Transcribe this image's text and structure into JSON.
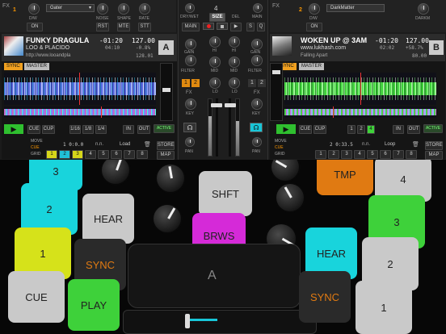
{
  "fx_left": {
    "label": "FX",
    "unit": "1",
    "effect": "Gater",
    "dw_label": "D/W",
    "on_label": "ON",
    "knob_labels": [
      "NOISE",
      "SHAPE",
      "RATE"
    ],
    "button_labels": [
      "RST",
      "MTE",
      "STT"
    ]
  },
  "fx_right": {
    "label": "FX",
    "unit": "2",
    "effect": "DarkMatter",
    "dw_label": "D/W",
    "on_label": "ON",
    "knob_labels": [
      "DARKM"
    ]
  },
  "mixer_top": {
    "dry_wet": "DRY/WET",
    "del": "DEL",
    "size_label": "SIZE",
    "size_value": "4",
    "main_left": "MAIN",
    "main_right": "MAIN",
    "s": "S",
    "q": "Q",
    "gain": "GAIN",
    "hi": "HI",
    "mid": "MID",
    "lo": "LO",
    "filter": "FILTER",
    "key": "KEY",
    "fx": "FX",
    "pan": "PAN",
    "fx_assign": [
      "1",
      "2"
    ]
  },
  "deck_a": {
    "letter": "A",
    "title": "FUNKY DRAGULA",
    "time": "-01:20",
    "bpm": "127.00",
    "artist": "LOO & PLACIDO",
    "elapsed": "04:10",
    "pitch": "-0.8%",
    "url": "http://www.looandpla",
    "tempo": "128.01",
    "sync": "SYNC",
    "master": "MASTER",
    "cue": "CUE",
    "cup": "CUP",
    "loop_sizes": [
      "1/16",
      "1/8",
      "1/4"
    ],
    "in": "IN",
    "out": "OUT",
    "active": "ACTIVE",
    "map": "MAP",
    "store": "STORE",
    "move": "MOVE",
    "cue_label": "CUE",
    "grid": "GRID",
    "move_value": "1 0:0.0",
    "nn": "n.n.",
    "mode": "Load",
    "hotcues": [
      "1",
      "2",
      "3",
      "4",
      "5",
      "6",
      "7",
      "8"
    ]
  },
  "deck_b": {
    "letter": "B",
    "title": "WOKEN UP @ 3AM",
    "time": "-01:20",
    "bpm": "127.00",
    "artist": "www.lukhash.com",
    "elapsed": "02:02",
    "pitch": "+58.7%",
    "album": "Falling Apart",
    "tempo": "80.00",
    "sync": "SYNC",
    "master": "MASTER",
    "cue": "CUE",
    "cup": "CUP",
    "loop_sizes": [
      "1",
      "2",
      "4"
    ],
    "in": "IN",
    "out": "OUT",
    "active": "ACTIVE",
    "map": "MAP",
    "store": "STORE",
    "move": "MOVE",
    "cue_label": "CUE",
    "grid": "GRID",
    "move_value": "2 0:33.5",
    "nn": "n.n.",
    "mode": "Loop",
    "hotcues": [
      "1",
      "2",
      "3",
      "4",
      "5",
      "6",
      "7",
      "8"
    ]
  },
  "controller": {
    "left_pads": [
      "3",
      "2",
      "HEAR",
      "1",
      "SYNC",
      "CUE",
      "PLAY"
    ],
    "center_pads": [
      "SHFT",
      "BRWS"
    ],
    "touch_label": "A",
    "right_pads": [
      "TMP",
      "4",
      "3",
      "HEAR",
      "2",
      "SYNC",
      "1"
    ]
  },
  "colors": {
    "cyan": "#18d4dc",
    "green": "#3ed13a",
    "yellow": "#d6e21a",
    "magenta": "#d52ad8",
    "orange": "#e07a12",
    "grey": "#c9c9c9"
  }
}
